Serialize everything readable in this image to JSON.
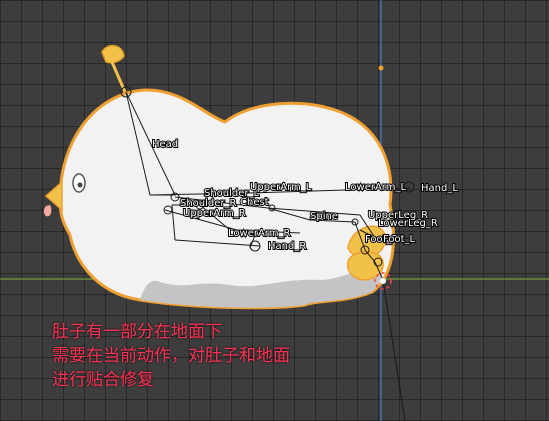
{
  "viewport": {
    "colors": {
      "background": "#3d3d3d",
      "grid": "#303030",
      "axis_x": "#7a9a3a",
      "axis_y": "#4a7ac8",
      "mesh": "#f2f2f2",
      "shadow": "#c8c8c8",
      "outline": "#f0a030",
      "beak": "#f2c14a",
      "tongue": "#f5a7a0",
      "bone_line": "#1a1a1a"
    },
    "bones": {
      "head": "Head",
      "shoulder_l": "Shoulder_L",
      "shoulder_r": "Shoulder_R",
      "chest": "Chest",
      "upperarm_l": "UpperArm_L",
      "upperarm_r": "UpperArm_R",
      "lowerarm_l": "LowerArm_L",
      "lowerarm_r": "LowerArm_R",
      "hand_l": "Hand_L",
      "hand_r": "Hand_R",
      "spine": "Spine",
      "upperleg_r": "UpperLeg_R",
      "lowerleg_r": "LowerLeg_R",
      "foot_r": "Foot_R",
      "foot_l": "Foot_L"
    }
  },
  "annotation": {
    "line1": "肚子有一部分在地面下",
    "line2": "需要在当前动作，对肚子和地面",
    "line3": "进行贴合修复"
  }
}
